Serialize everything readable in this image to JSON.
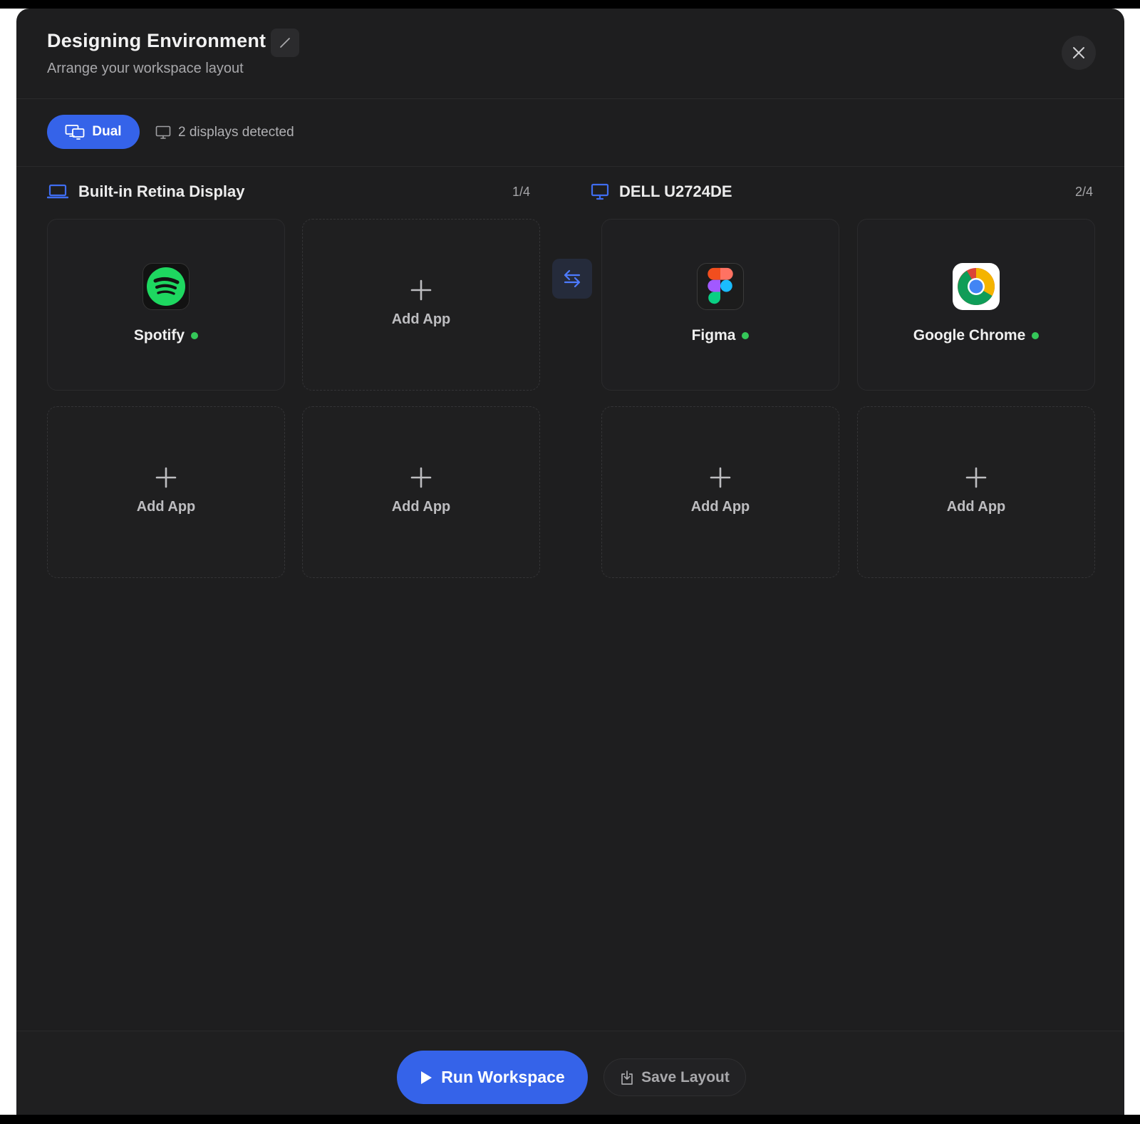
{
  "header": {
    "title": "Designing Environment",
    "subtitle": "Arrange your workspace layout"
  },
  "modebar": {
    "mode_label": "Dual",
    "detected_text": "2 displays detected"
  },
  "displays": [
    {
      "name": "Built-in Retina Display",
      "count": "1/4",
      "slots": [
        {
          "type": "app",
          "name": "Spotify",
          "icon": "spotify-icon"
        },
        {
          "type": "empty",
          "label": "Add App"
        },
        {
          "type": "empty",
          "label": "Add App"
        },
        {
          "type": "empty",
          "label": "Add App"
        }
      ]
    },
    {
      "name": "DELL U2724DE",
      "count": "2/4",
      "slots": [
        {
          "type": "app",
          "name": "Figma",
          "icon": "figma-icon"
        },
        {
          "type": "app",
          "name": "Google Chrome",
          "icon": "chrome-icon"
        },
        {
          "type": "empty",
          "label": "Add App"
        },
        {
          "type": "empty",
          "label": "Add App"
        }
      ]
    }
  ],
  "footer": {
    "run_label": "Run Workspace",
    "save_label": "Save Layout"
  },
  "colors": {
    "accent": "#3563e9",
    "running": "#35c759",
    "background": "#1e1e1f"
  }
}
